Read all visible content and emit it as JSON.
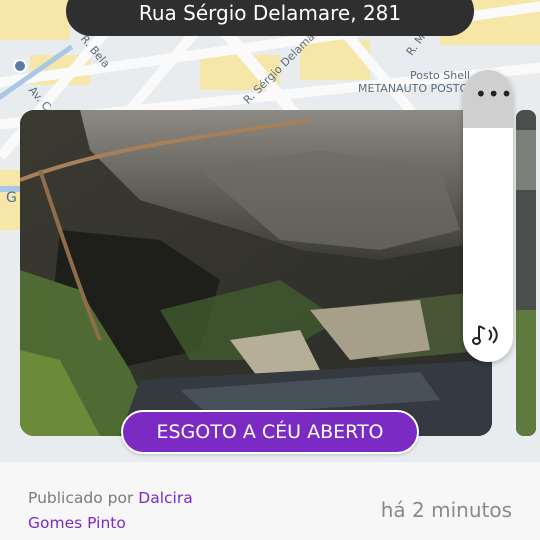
{
  "header": {
    "address": "Rua Sérgio Delamare, 281"
  },
  "map": {
    "labels": {
      "street_1": "R. Bela",
      "street_2": "R. Sérgio Delamare",
      "street_3": "R. M",
      "street_4": "Av. C",
      "poi_1": "Posto Shell",
      "poi_2": "METANAUTO POSTO",
      "google_letter": "G"
    }
  },
  "report": {
    "category": "ESGOTO A CÉU ABERTO",
    "published_prefix": "Publicado por",
    "author": "Dalcira Gomes Pinto",
    "time_ago": "há 2 minutos"
  },
  "icons": {
    "more": "more-horizontal-icon",
    "sound": "sound-icon",
    "transit": "bus-stop-icon"
  },
  "colors": {
    "accent": "#7b2ac4",
    "pill": "#2f2f2f"
  }
}
